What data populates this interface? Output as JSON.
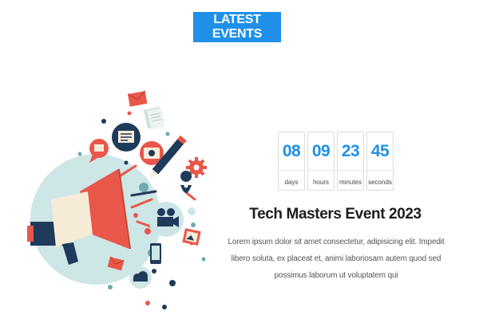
{
  "header": {
    "button_label": "LATEST EVENTS"
  },
  "countdown": [
    {
      "value": "08",
      "unit": "days"
    },
    {
      "value": "09",
      "unit": "hours"
    },
    {
      "value": "23",
      "unit": "minutes"
    },
    {
      "value": "45",
      "unit": "seconds"
    }
  ],
  "event": {
    "title": "Tech Masters Event 2023",
    "description": "Lorem ipsum dolor sit amet consectetur, adipisicing elit. Impedit libero soluta, ex placeat et, animi laboriosam autem quod sed possimus laborum ut voluptatem qui"
  },
  "colors": {
    "accent": "#1e90e8",
    "red": "#e8574a",
    "navy": "#1f3a5a",
    "teal_circle": "#cde6e6",
    "teal": "#6fa9b2",
    "cream": "#f6ebd7"
  },
  "illustration": {
    "icons": [
      "megaphone-icon",
      "newspaper-icon",
      "speech-bubble-icon",
      "envelope-icon",
      "camera-icon",
      "pencil-icon",
      "gear-icon",
      "map-pin-icon",
      "film-camera-icon",
      "smartphone-icon",
      "photo-icon",
      "cloud-icon"
    ]
  }
}
